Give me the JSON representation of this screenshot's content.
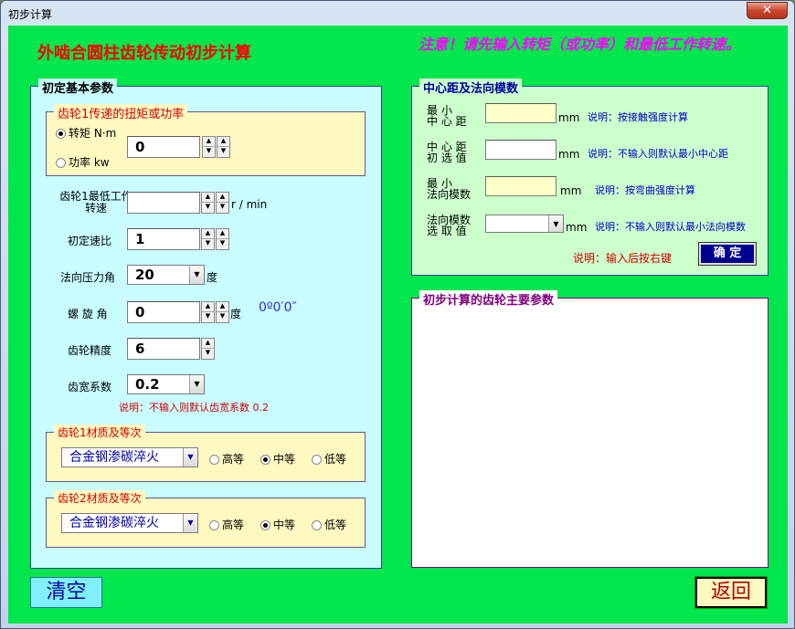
{
  "window": {
    "title": "初步计算",
    "close": "✕"
  },
  "heading": "外啮合圆柱齿轮传动初步计算",
  "note": "注意！请先输入转矩（或功率）和最低工作转速。",
  "basic": {
    "title": "初定基本参数",
    "torque_frame_title": "齿轮1传递的扭矩或功率",
    "torque_label": "转矩  N·m",
    "power_label": "功率  kw",
    "torque_value": "0",
    "speed_label": "齿轮1最低工作转速",
    "speed_unit": "r / min",
    "ratio_label": "初定速比",
    "ratio_value": "1",
    "pressure_label": "法向压力角",
    "pressure_value": "20",
    "pressure_unit": "度",
    "helix_label": "螺 旋 角",
    "helix_value": "0",
    "helix_unit": "度",
    "helix_readout": "0º0′0″",
    "precision_label": "齿轮精度",
    "precision_value": "6",
    "width_label": "齿宽系数",
    "width_value": "0.2",
    "width_note": "说明：不输入则默认齿宽系数 0.2"
  },
  "material1": {
    "title": "齿轮1材质及等次",
    "value": "合金钢渗碳淬火",
    "options": [
      "高等",
      "中等",
      "低等"
    ],
    "selected": 1
  },
  "material2": {
    "title": "齿轮2材质及等次",
    "value": "合金钢渗碳淬火",
    "options": [
      "高等",
      "中等",
      "低等"
    ],
    "selected": 1
  },
  "center": {
    "title": "中心距及法向模数",
    "row1_label1": "最    小",
    "row1_label2": "中 心 距",
    "row1_unit": "mm",
    "row1_note": "说明：按接触强度计算",
    "row2_label1": "中 心 距",
    "row2_label2": "初 选 值",
    "row2_unit": "mm",
    "row2_note": "说明：不输入则默认最小中心距",
    "row3_label1": "最    小",
    "row3_label2": "法向模数",
    "row3_unit": "mm",
    "row3_note": "说明：按弯曲强度计算",
    "row4_label1": "法向模数",
    "row4_label2": "选 取 值",
    "row4_unit": "mm",
    "row4_note": "说明：不输入则默认最小法向模数",
    "confirm_note": "说明：输入后按右键",
    "confirm_label": "确 定"
  },
  "results": {
    "title": "初步计算的齿轮主要参数"
  },
  "buttons": {
    "clear": "清空",
    "back": "返回"
  }
}
